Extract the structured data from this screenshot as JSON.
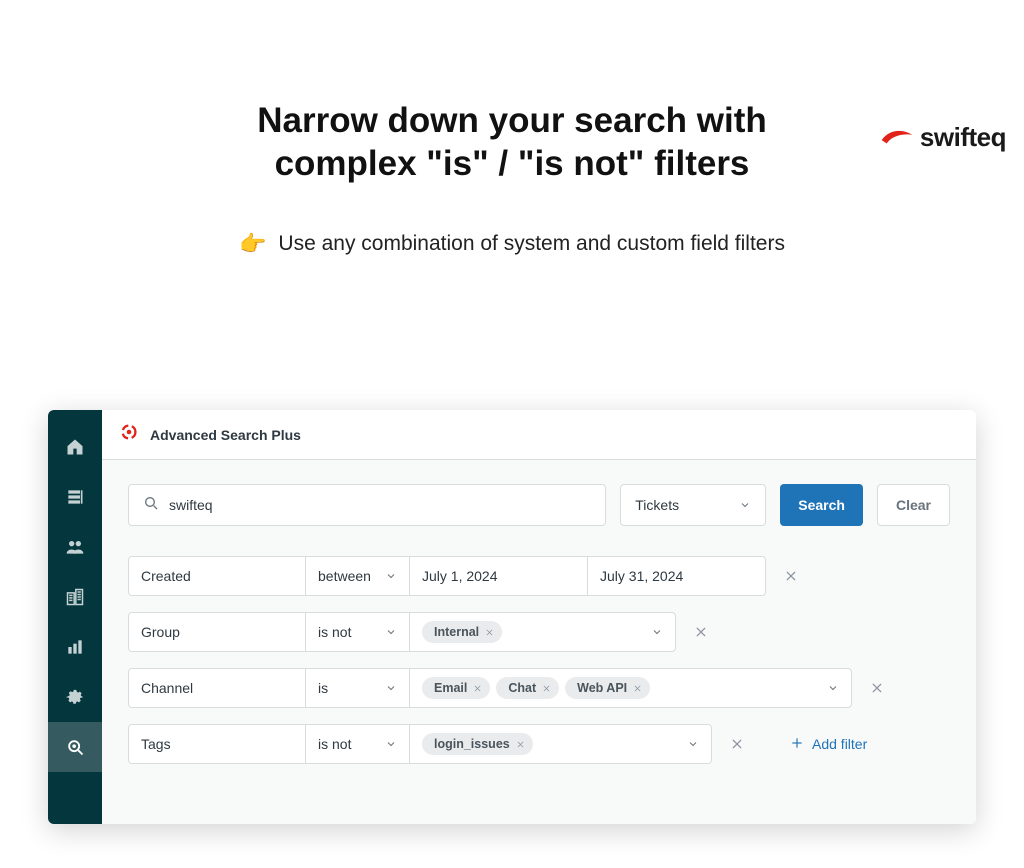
{
  "brand": {
    "name": "swifteq"
  },
  "headline_line1": "Narrow down your search with",
  "headline_line2": "complex \"is\" / \"is not\" filters",
  "subline": "Use any combination of system and custom field filters",
  "app": {
    "title": "Advanced Search Plus",
    "search_value": "swifteq",
    "scope_label": "Tickets",
    "search_button": "Search",
    "clear_button": "Clear",
    "add_filter_label": "Add filter",
    "filters": {
      "created": {
        "field": "Created",
        "op": "between",
        "from": "July 1, 2024",
        "to": "July 31, 2024"
      },
      "group": {
        "field": "Group",
        "op": "is not",
        "pills": [
          "Internal"
        ]
      },
      "channel": {
        "field": "Channel",
        "op": "is",
        "pills": [
          "Email",
          "Chat",
          "Web API"
        ]
      },
      "tags": {
        "field": "Tags",
        "op": "is not",
        "pills": [
          "login_issues"
        ]
      }
    }
  }
}
